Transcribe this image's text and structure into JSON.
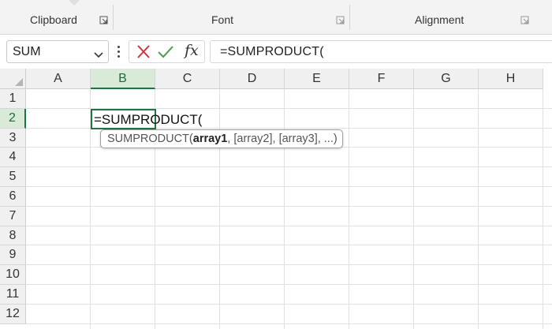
{
  "ribbon": {
    "groups": [
      {
        "label": "Clipboard"
      },
      {
        "label": "Font"
      },
      {
        "label": "Alignment"
      }
    ]
  },
  "formula_bar": {
    "name_box": "SUM",
    "fx_label": "fx",
    "formula": "=SUMPRODUCT("
  },
  "grid": {
    "columns": [
      "A",
      "B",
      "C",
      "D",
      "E",
      "F",
      "G",
      "H"
    ],
    "rows": [
      "1",
      "2",
      "3",
      "4",
      "5",
      "6",
      "7",
      "8",
      "9",
      "10",
      "11",
      "12"
    ],
    "active_column": "B",
    "active_row": "2",
    "active_cell_text": "=SUMPRODUCT("
  },
  "tooltip": {
    "function_name": "SUMPRODUCT(",
    "arg_current": "array1",
    "args_rest": ", [array2], [array3], ...)"
  },
  "colors": {
    "accent": "#217346",
    "cancel": "#d13438",
    "enter": "#4a9b4a"
  }
}
